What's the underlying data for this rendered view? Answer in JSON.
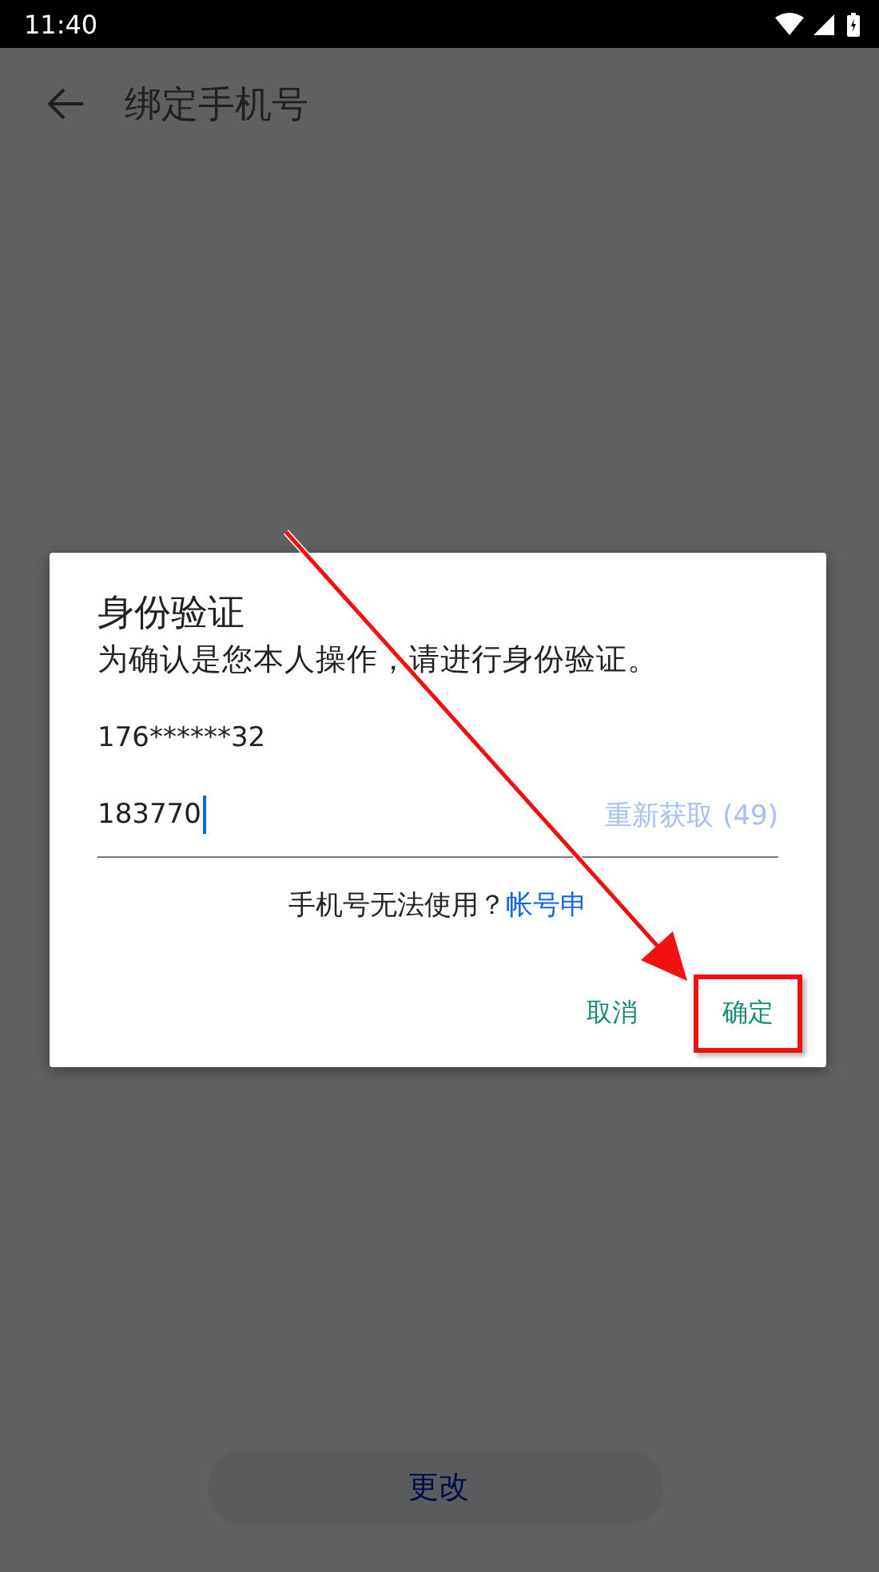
{
  "status_bar": {
    "time": "11:40"
  },
  "app_bar": {
    "title": "绑定手机号"
  },
  "dialog": {
    "title": "身份验证",
    "message": "为确认是您本人操作，请进行身份验证。",
    "phone": "176******32",
    "code_field": {
      "value": "183770",
      "focused": true
    },
    "resend": {
      "label": "重新获取 (49)",
      "disabled": true
    },
    "help_text": "手机号无法使用？",
    "help_link": "帐号申",
    "buttons": [
      {
        "label": "取消",
        "highlighted": false
      },
      {
        "label": "确定",
        "highlighted": true
      }
    ]
  },
  "bottom_button": {
    "label": "更改"
  },
  "annotations": [
    {
      "kind": "arrow"
    }
  ]
}
